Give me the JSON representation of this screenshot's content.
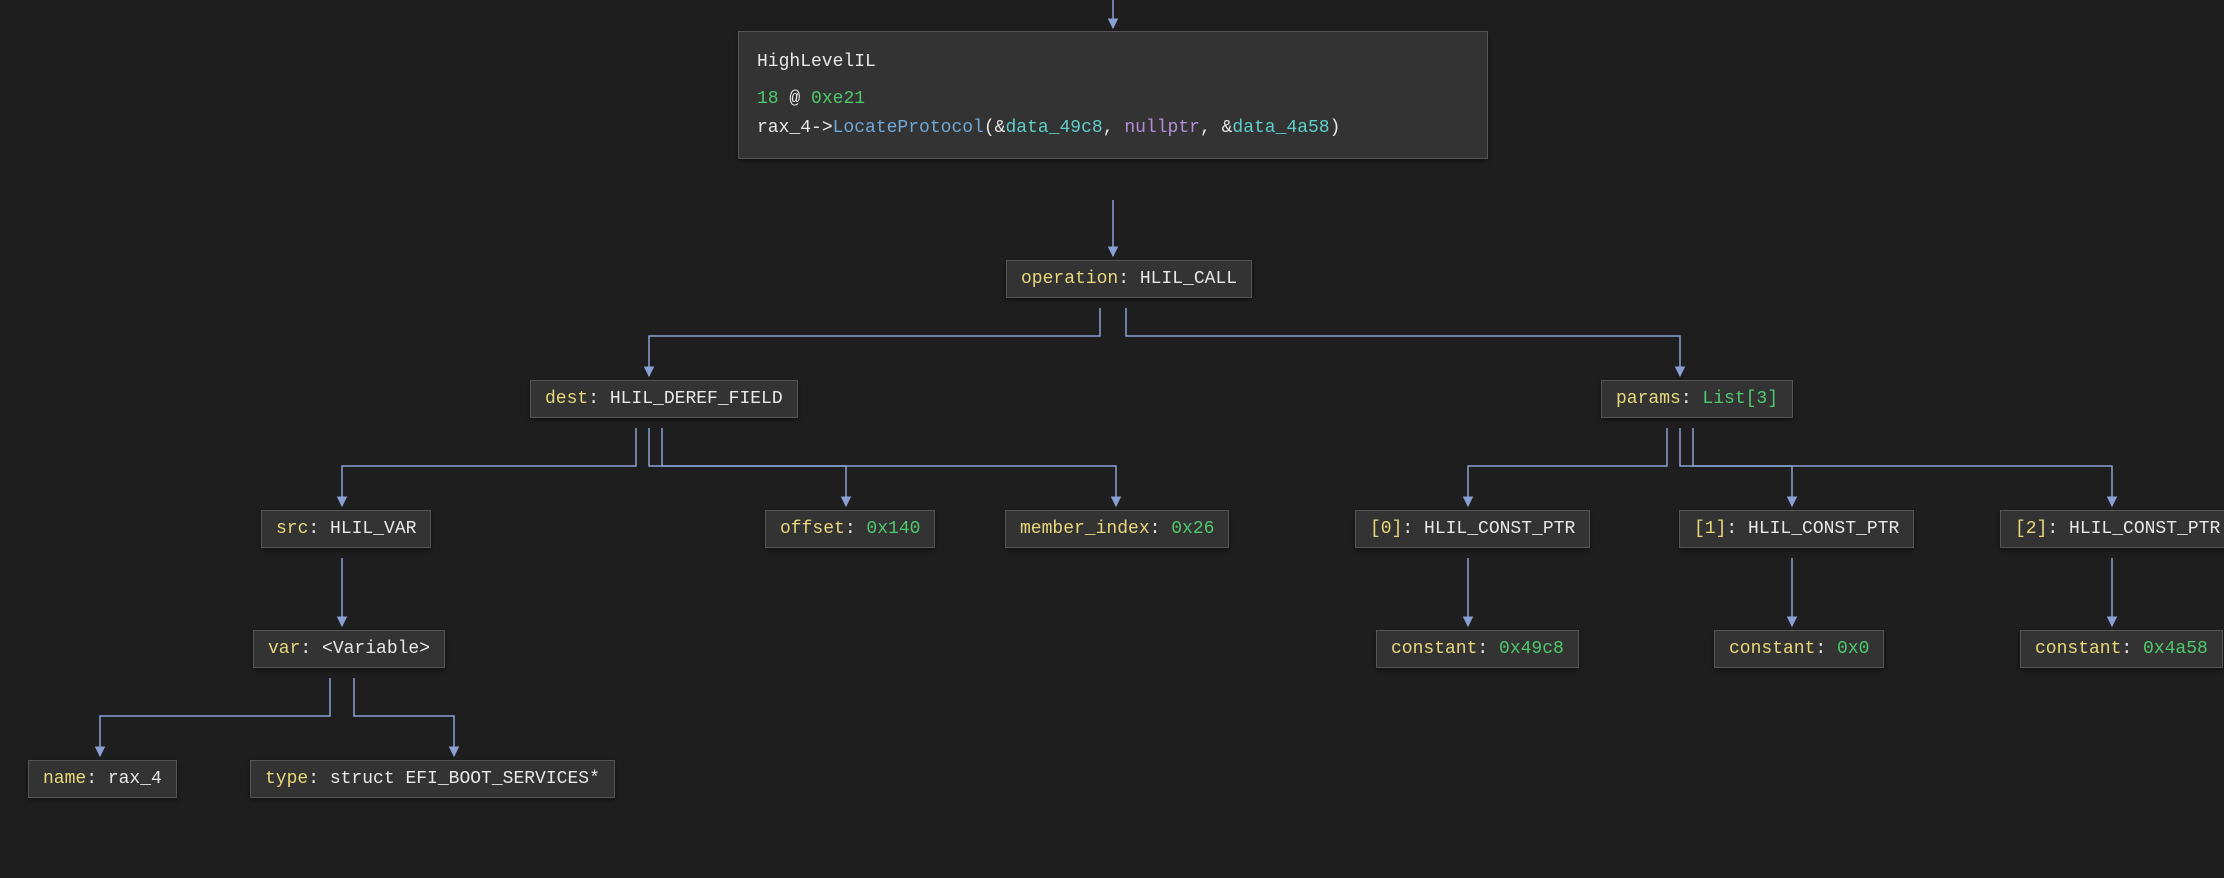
{
  "root": {
    "title": "HighLevelIL",
    "index": "18",
    "at": "@",
    "addr": "0xe21",
    "obj": "rax_4",
    "arrow": "->",
    "fn": "LocateProtocol",
    "lparen": "(",
    "rparen": ")",
    "amp1": "&",
    "arg1": "data_49c8",
    "comma1": ",",
    "arg2": "nullptr",
    "comma2": ",",
    "amp2": "&",
    "arg3": "data_4a58"
  },
  "op": {
    "key": "operation",
    "colon": ": ",
    "val": "HLIL_CALL"
  },
  "dest": {
    "key": "dest",
    "colon": ": ",
    "val": "HLIL_DEREF_FIELD"
  },
  "src": {
    "key": "src",
    "colon": ": ",
    "val": "HLIL_VAR"
  },
  "offset": {
    "key": "offset",
    "colon": ": ",
    "val": "0x140"
  },
  "member_index": {
    "key": "member_index",
    "colon": ": ",
    "val": "0x26"
  },
  "var": {
    "key": "var",
    "colon": ": ",
    "val": "<Variable>"
  },
  "name": {
    "key": "name",
    "colon": ": ",
    "val": "rax_4"
  },
  "type": {
    "key": "type",
    "colon": ": ",
    "val": "struct EFI_BOOT_SERVICES*"
  },
  "params": {
    "key": "params",
    "colon": ": ",
    "val": "List[3]"
  },
  "p0": {
    "key": "[0]",
    "colon": ": ",
    "val": "HLIL_CONST_PTR"
  },
  "p1": {
    "key": "[1]",
    "colon": ": ",
    "val": "HLIL_CONST_PTR"
  },
  "p2": {
    "key": "[2]",
    "colon": ": ",
    "val": "HLIL_CONST_PTR"
  },
  "c0": {
    "key": "constant",
    "colon": ": ",
    "val": "0x49c8"
  },
  "c1": {
    "key": "constant",
    "colon": ": ",
    "val": "0x0"
  },
  "c2": {
    "key": "constant",
    "colon": ": ",
    "val": "0x4a58"
  }
}
